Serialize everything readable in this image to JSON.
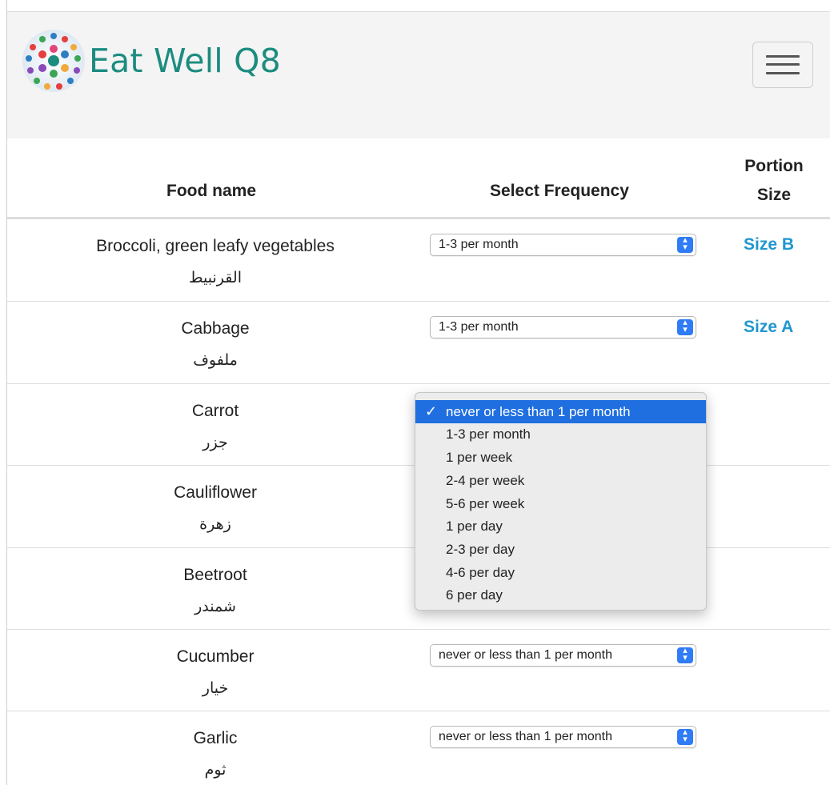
{
  "brand": {
    "name": "Eat Well Q8"
  },
  "table": {
    "headers": {
      "food": "Food name",
      "frequency": "Select Frequency",
      "portion_line1": "Portion",
      "portion_line2": "Size"
    },
    "rows": [
      {
        "en": "Broccoli, green leafy vegetables",
        "ar": "القرنبيط",
        "frequency": "1-3 per month",
        "portion": "Size B"
      },
      {
        "en": "Cabbage",
        "ar": "ملفوف",
        "frequency": "1-3 per month",
        "portion": "Size A"
      },
      {
        "en": "Carrot",
        "ar": "جزر",
        "frequency": "",
        "portion": ""
      },
      {
        "en": "Cauliflower",
        "ar": "زهرة",
        "frequency": "",
        "portion": ""
      },
      {
        "en": "Beetroot",
        "ar": "شمندر",
        "frequency": "",
        "portion": ""
      },
      {
        "en": "Cucumber",
        "ar": "خيار",
        "frequency": "never or less than 1 per month",
        "portion": ""
      },
      {
        "en": "Garlic",
        "ar": "ثوم",
        "frequency": "never or less than 1 per month",
        "portion": ""
      }
    ]
  },
  "dropdown": {
    "checkmark": "✓",
    "options": [
      "never or less than 1 per month",
      "1-3 per month",
      "1 per week",
      "2-4 per week",
      "5-6 per week",
      "1 per day",
      "2-3 per day",
      "4-6 per day",
      "6 per day"
    ],
    "selected_index": 0
  },
  "colors": {
    "brand": "#1c8c7f",
    "link": "#1f97cf",
    "highlight": "#1f6fe0"
  }
}
